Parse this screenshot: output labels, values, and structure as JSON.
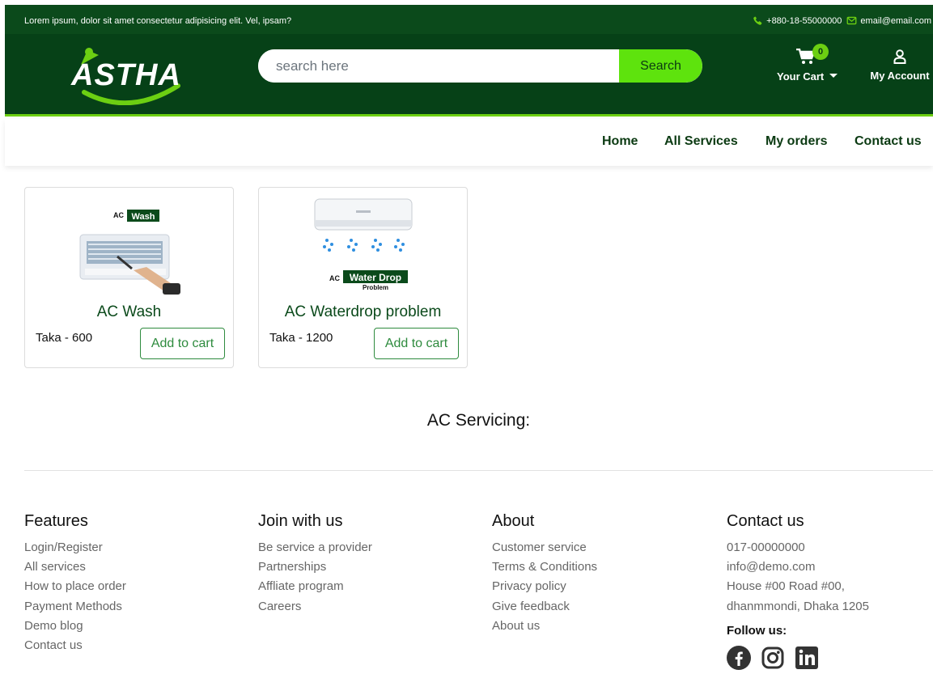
{
  "topbar": {
    "tagline": "Lorem ipsum, dolor sit amet consectetur adipisicing elit. Vel, ipsam?",
    "phone": "+880-18-55000000",
    "email": "email@email.com"
  },
  "header": {
    "logo_text": "ASTHA",
    "search_placeholder": "search here",
    "search_button": "Search",
    "cart_count": "0",
    "cart_label": "Your Cart",
    "account_label": "My Account"
  },
  "nav": {
    "items": [
      {
        "label": "Home"
      },
      {
        "label": "All Services"
      },
      {
        "label": "My orders"
      },
      {
        "label": "Contact us"
      }
    ]
  },
  "products": [
    {
      "image_caption": "AC",
      "image_highlight": "Wash",
      "title": "AC Wash",
      "price": "Taka - 600",
      "button": "Add to cart"
    },
    {
      "image_caption": "AC",
      "image_highlight": "Water Drop",
      "image_sub": "Problem",
      "title": "AC Waterdrop problem",
      "price": "Taka - 1200",
      "button": "Add to cart"
    }
  ],
  "section_title": "AC Servicing:",
  "footer": {
    "features": {
      "title": "Features",
      "items": [
        "Login/Register",
        "All services",
        "How to place order",
        "Payment Methods",
        "Demo blog",
        "Contact us"
      ]
    },
    "join": {
      "title": "Join with us",
      "items": [
        "Be service a provider",
        "Partnerships",
        "Affliate program",
        "Careers"
      ]
    },
    "about": {
      "title": "About",
      "items": [
        "Customer service",
        "Terms & Conditions",
        "Privacy policy",
        "Give feedback",
        "About us"
      ]
    },
    "contact": {
      "title": "Contact us",
      "items": [
        "017-00000000",
        "info@demo.com",
        "House #00 Road #00,",
        "dhanmmondi, Dhaka 1205"
      ],
      "follow": "Follow us:"
    }
  },
  "colors": {
    "header_bg": "#064117",
    "topbar_bg": "#0b4a1b",
    "accent": "#5ee30d",
    "button_green": "#2e8b3e"
  },
  "icons": [
    "phone-icon",
    "mail-icon",
    "cart-icon",
    "user-icon",
    "facebook-icon",
    "instagram-icon",
    "linkedin-icon"
  ]
}
